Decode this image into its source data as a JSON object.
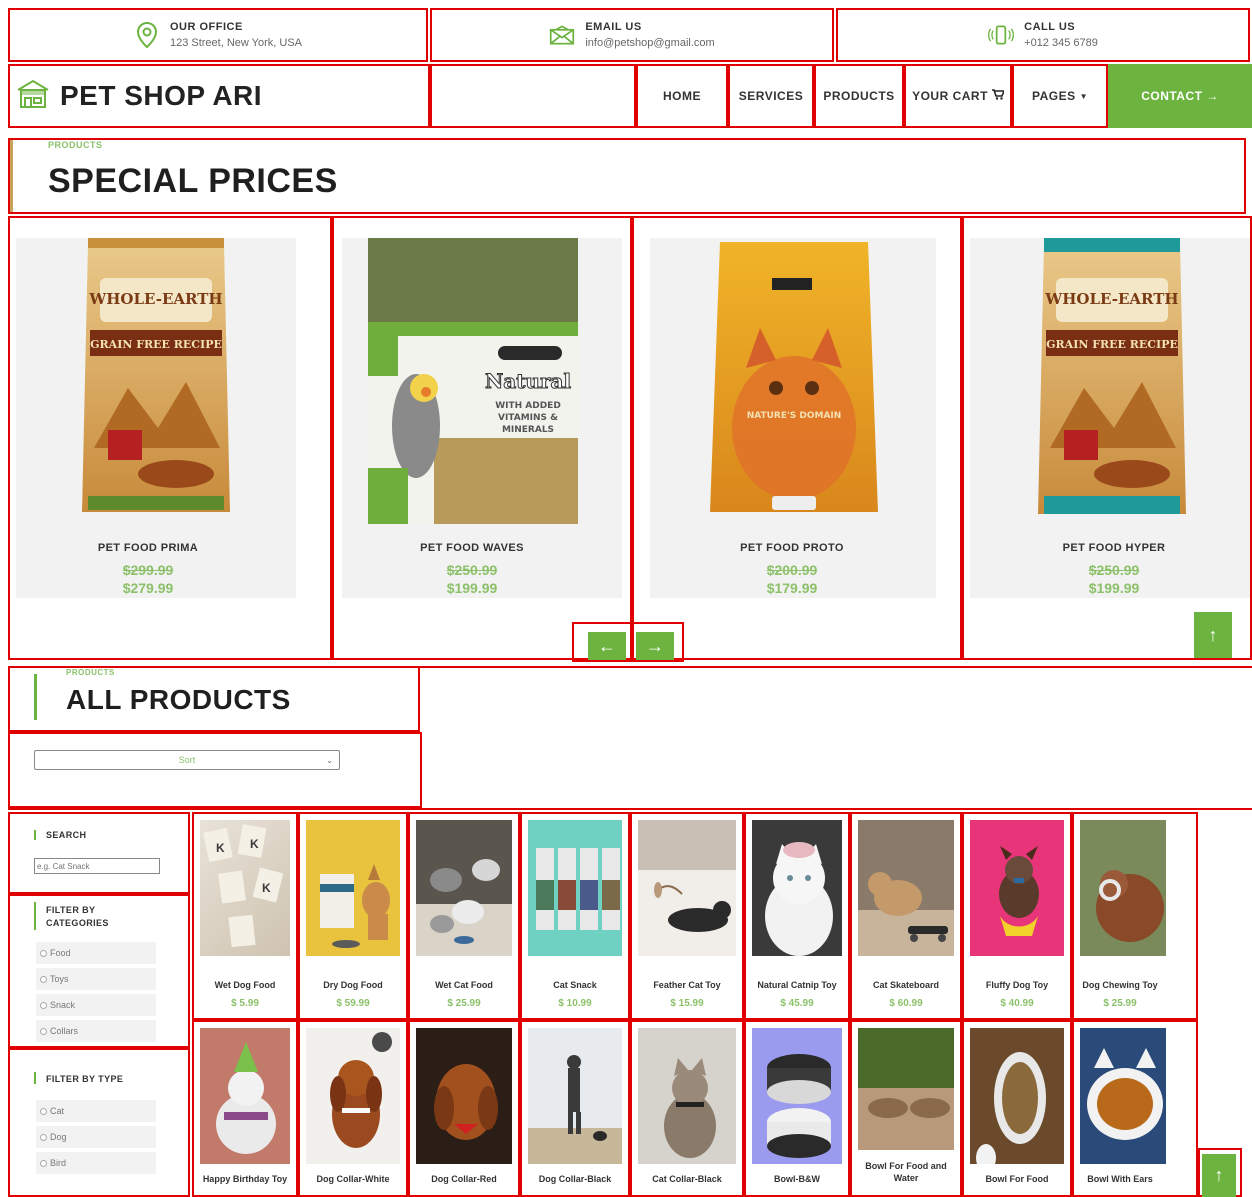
{
  "topbar": {
    "office": {
      "title": "OUR OFFICE",
      "value": "123 Street, New York, USA",
      "icon": "map-pin-icon"
    },
    "email": {
      "title": "EMAIL US",
      "value": "info@petshop@gmail.com",
      "icon": "envelope-icon"
    },
    "call": {
      "title": "CALL US",
      "value": "+012 345 6789",
      "icon": "phone-icon"
    }
  },
  "brand": {
    "name": "PET SHOP ARI",
    "icon": "shop-icon"
  },
  "nav": {
    "home": "HOME",
    "services": "SERVICES",
    "products": "PRODUCTS",
    "cart": "YOUR CART",
    "pages": "PAGES",
    "contact": "CONTACT →"
  },
  "special": {
    "kicker": "PRODUCTS",
    "title": "SPECIAL PRICES",
    "items": [
      {
        "name": "PET FOOD PRIMA",
        "old": "$299.99",
        "new": "$279.99"
      },
      {
        "name": "PET FOOD WAVES",
        "old": "$250.99",
        "new": "$199.99"
      },
      {
        "name": "PET FOOD PROTO",
        "old": "$200.99",
        "new": "$179.99"
      },
      {
        "name": "PET FOOD HYPER",
        "old": "$250.99",
        "new": "$199.99"
      }
    ],
    "prev": "←",
    "next": "→",
    "top": "↑"
  },
  "all": {
    "kicker": "PRODUCTS",
    "title": "ALL PRODUCTS",
    "sort": "Sort"
  },
  "sidebar": {
    "search_label": "SEARCH",
    "search_placeholder": "e.g. Cat Snack",
    "cat_label": "FILTER BY CATEGORIES",
    "categories": [
      "Food",
      "Toys",
      "Snack",
      "Collars"
    ],
    "type_label": "FILTER BY TYPE",
    "types": [
      "Cat",
      "Dog",
      "Bird"
    ]
  },
  "grid": {
    "row1": [
      {
        "name": "Wet Dog Food",
        "price": "$ 5.99"
      },
      {
        "name": "Dry Dog Food",
        "price": "$ 59.99"
      },
      {
        "name": "Wet Cat Food",
        "price": "$ 25.99"
      },
      {
        "name": "Cat Snack",
        "price": "$ 10.99"
      },
      {
        "name": "Feather Cat Toy",
        "price": "$ 15.99"
      },
      {
        "name": "Natural Catnip Toy",
        "price": "$ 45.99"
      },
      {
        "name": "Cat Skateboard",
        "price": "$ 60.99"
      },
      {
        "name": "Fluffy Dog Toy",
        "price": "$ 40.99"
      },
      {
        "name": "Dog Chewing Toy",
        "price": "$ 25.99"
      }
    ],
    "row2": [
      {
        "name": "Happy Birthday Toy"
      },
      {
        "name": "Dog Collar-White"
      },
      {
        "name": "Dog Collar-Red"
      },
      {
        "name": "Dog Collar-Black"
      },
      {
        "name": "Cat Collar-Black"
      },
      {
        "name": "Bowl-B&W"
      },
      {
        "name": "Bowl For Food and Water"
      },
      {
        "name": "Bowl For Food"
      },
      {
        "name": "Bowl With Ears"
      }
    ],
    "top": "↑"
  },
  "colors": {
    "accent": "#6cb33f",
    "price": "#8cc16a",
    "outline": "#e00000"
  }
}
